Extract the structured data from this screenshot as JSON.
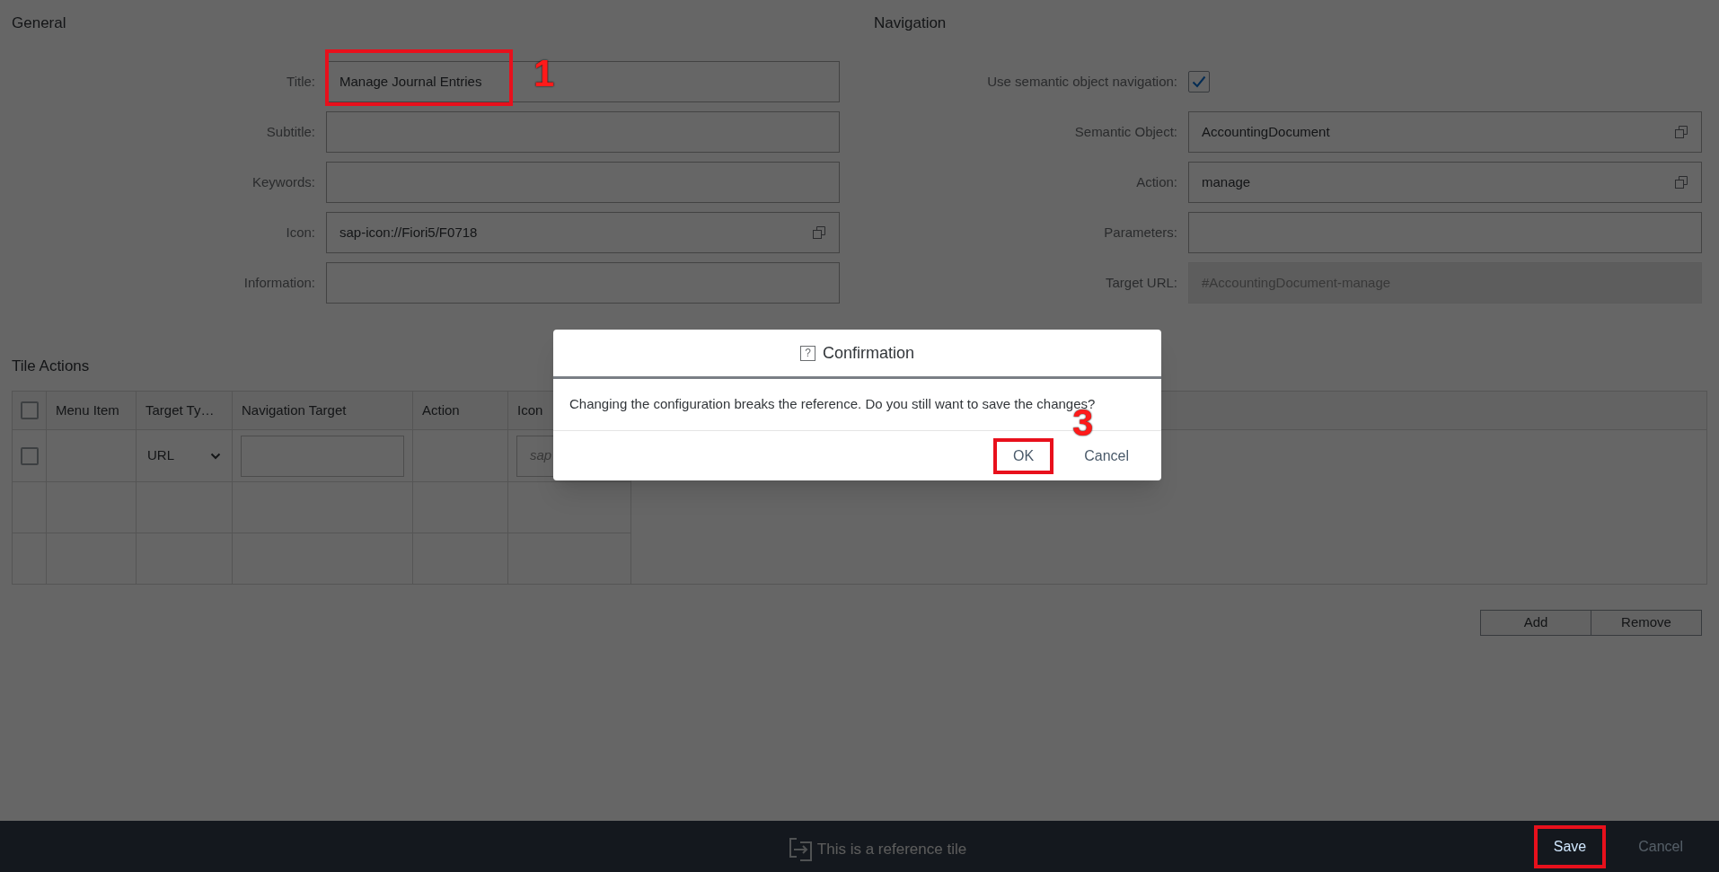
{
  "general": {
    "heading": "General",
    "fields": [
      {
        "kind": "text",
        "label": "Title:",
        "value": "Manage Journal Entries",
        "value_help": false,
        "disabled": false,
        "annotation": "1"
      },
      {
        "kind": "text",
        "label": "Subtitle:",
        "value_help": false,
        "disabled": false
      },
      {
        "kind": "text",
        "label": "Keywords:",
        "value_help": false,
        "disabled": false
      },
      {
        "kind": "text",
        "label": "Icon:",
        "value": "sap-icon://Fiori5/F0718",
        "value_help": true,
        "disabled": false
      },
      {
        "kind": "text",
        "label": "Information:",
        "value_help": false,
        "disabled": false
      }
    ]
  },
  "navigation": {
    "heading": "Navigation",
    "fields": [
      {
        "kind": "checkbox",
        "label": "Use semantic object navigation:",
        "checked": true
      },
      {
        "kind": "text",
        "label": "Semantic Object:",
        "value": "AccountingDocument",
        "value_help": true,
        "disabled": false
      },
      {
        "kind": "text",
        "label": "Action:",
        "value": "manage",
        "value_help": true,
        "disabled": false
      },
      {
        "kind": "text",
        "label": "Parameters:",
        "value_help": false,
        "disabled": false
      },
      {
        "kind": "text",
        "label": "Target URL:",
        "value": "#AccountingDocument-manage",
        "value_help": false,
        "disabled": true
      }
    ]
  },
  "tile_actions": {
    "heading": "Tile Actions",
    "header_checked": false,
    "columns": [
      "Menu Item",
      "Target Ty…",
      "Navigation Target",
      "Action",
      "Icon"
    ],
    "rows": [
      {
        "kind": "entry",
        "checked": false,
        "target_type": "URL",
        "icon_placeholder": "sap"
      },
      {
        "kind": "empty"
      },
      {
        "kind": "empty"
      }
    ],
    "buttons": [
      "Add",
      "Remove"
    ]
  },
  "dialog": {
    "icon": "?",
    "title": "Confirmation",
    "message": "Changing the configuration breaks the reference. Do you still want to save the changes?",
    "buttons": [
      {
        "label": "OK",
        "annotation": "3"
      },
      {
        "label": "Cancel"
      }
    ]
  },
  "footer": {
    "message": "This is a reference tile",
    "buttons": [
      {
        "label": "Save",
        "highlight": true
      },
      {
        "label": "Cancel",
        "highlight": false
      }
    ]
  }
}
